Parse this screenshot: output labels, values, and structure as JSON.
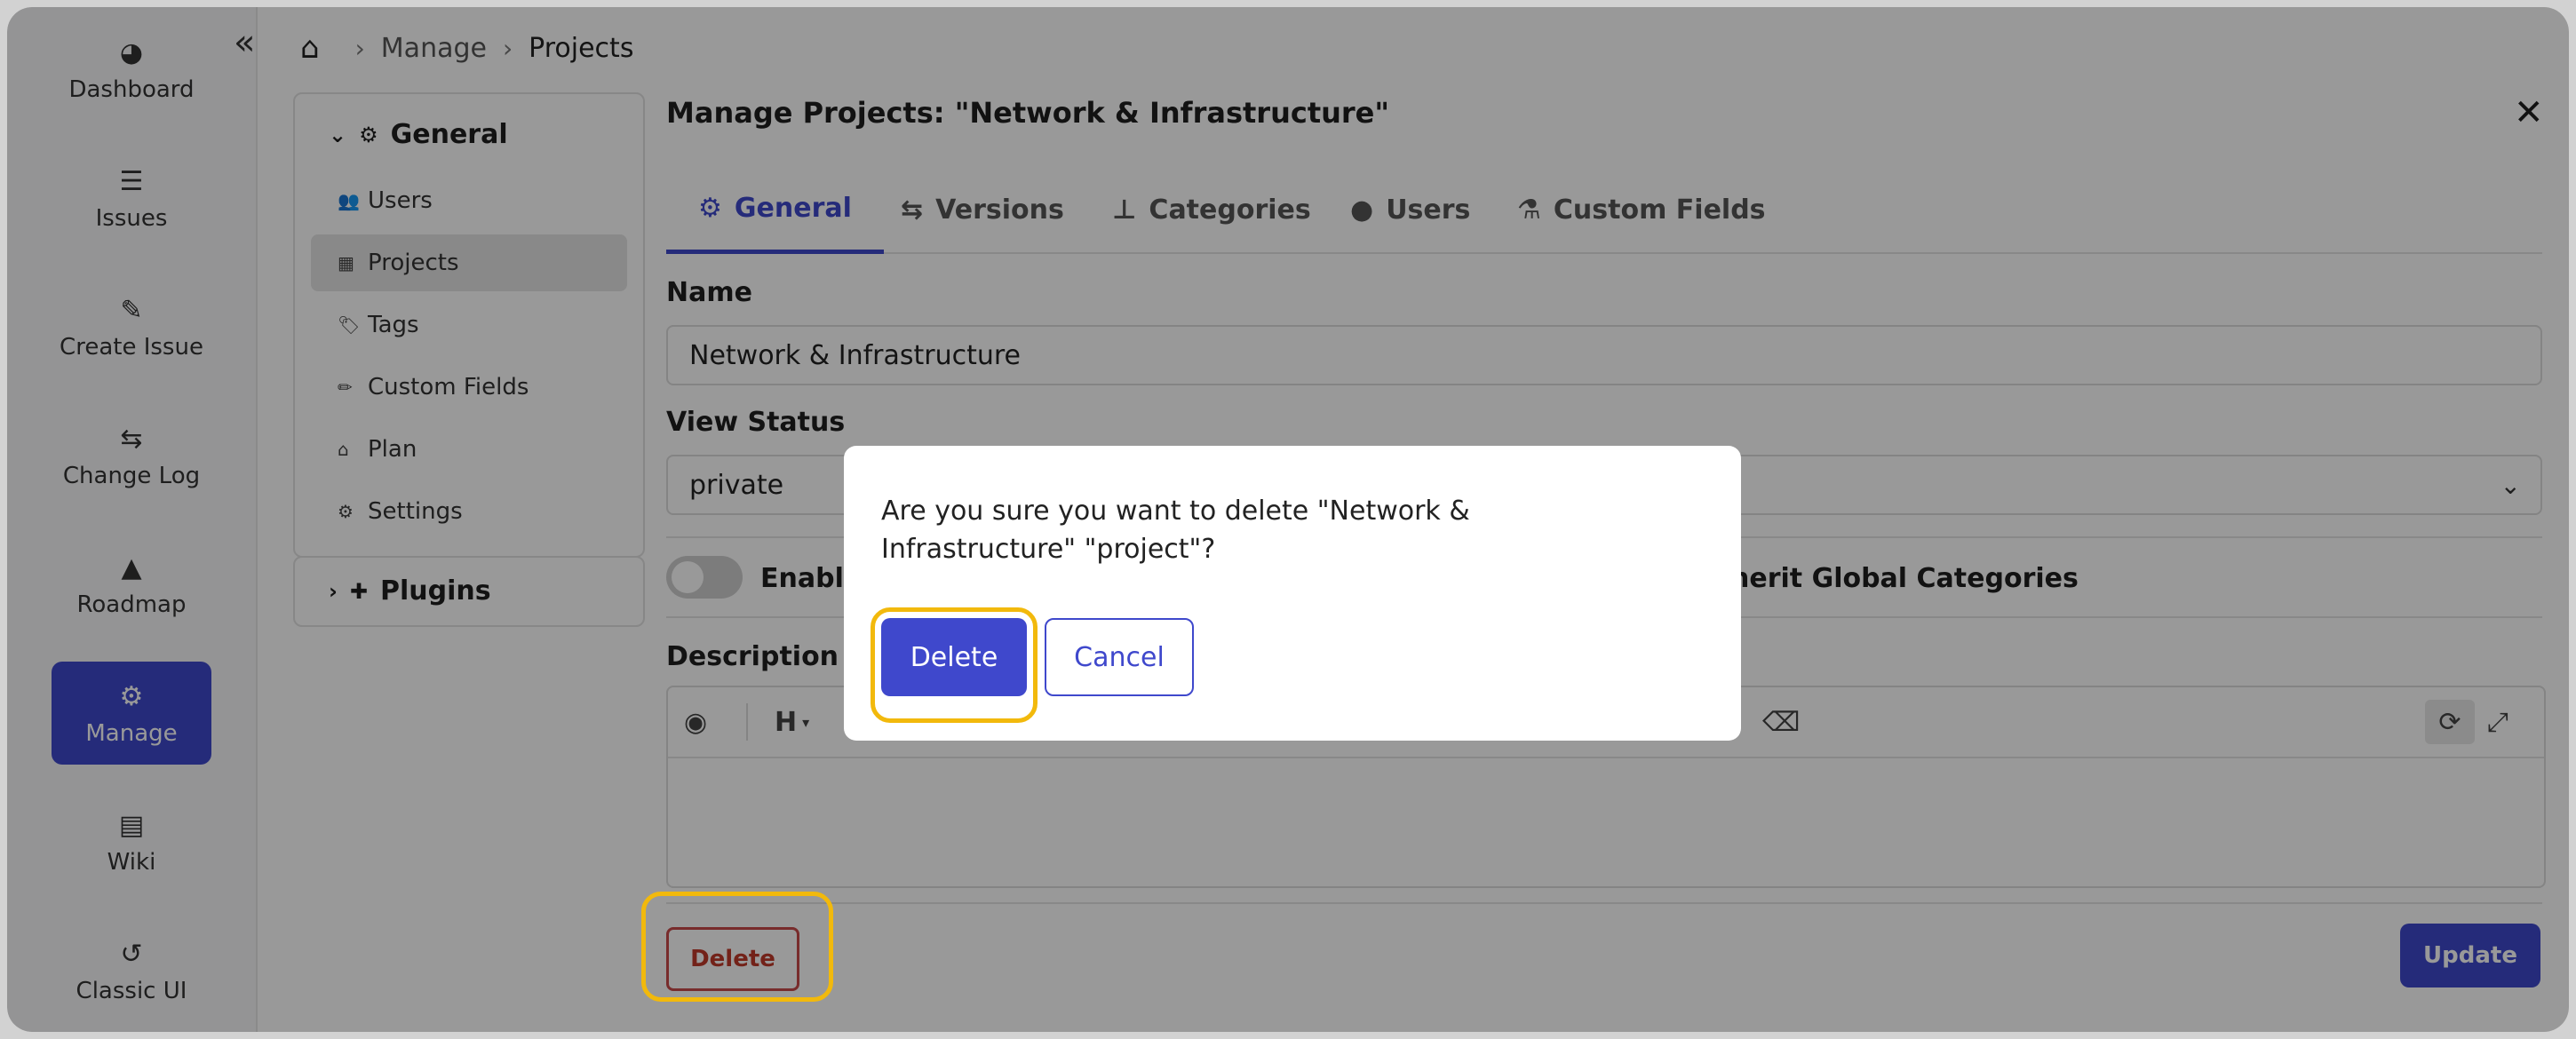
{
  "sidebar": {
    "collapse_icon": "double-chevron-left-icon",
    "items": [
      {
        "label": "Dashboard",
        "icon": "dashboard-gauge-icon"
      },
      {
        "label": "Issues",
        "icon": "list-icon"
      },
      {
        "label": "Create Issue",
        "icon": "edit-icon"
      },
      {
        "label": "Change Log",
        "icon": "retweet-icon"
      },
      {
        "label": "Roadmap",
        "icon": "road-icon"
      },
      {
        "label": "Manage",
        "icon": "cogs-icon",
        "active": true
      },
      {
        "label": "Wiki",
        "icon": "file-icon"
      },
      {
        "label": "Classic UI",
        "icon": "history-icon"
      }
    ],
    "active_color": "#3f48cc"
  },
  "breadcrumb": {
    "home_icon": "home-icon",
    "items": [
      "Manage",
      "Projects"
    ]
  },
  "settings_menu": {
    "general": {
      "title": "General",
      "items": [
        {
          "label": "Users",
          "icon": "users-icon"
        },
        {
          "label": "Projects",
          "icon": "table-icon",
          "active": true
        },
        {
          "label": "Tags",
          "icon": "tags-icon"
        },
        {
          "label": "Custom Fields",
          "icon": "pencil-icon"
        },
        {
          "label": "Plan",
          "icon": "bank-icon"
        },
        {
          "label": "Settings",
          "icon": "gear-icon"
        }
      ]
    },
    "plugins": {
      "title": "Plugins"
    }
  },
  "panel": {
    "title": "Manage Projects: \"Network & Infrastructure\"",
    "tabs": [
      {
        "label": "General",
        "icon": "gear-icon",
        "active": true
      },
      {
        "label": "Versions",
        "icon": "retweet-icon"
      },
      {
        "label": "Categories",
        "icon": "sitemap-icon"
      },
      {
        "label": "Users",
        "icon": "user-icon"
      },
      {
        "label": "Custom Fields",
        "icon": "flask-icon"
      }
    ],
    "name_label": "Name",
    "name_value": "Network & Infrastructure",
    "view_status_label": "View Status",
    "view_status_value": "private",
    "toggle_enable_label": "Enable",
    "toggle_inherit_label": "herit Global Categories",
    "description_label": "Description",
    "editor_toolbar": {
      "heading": "H",
      "icons": [
        "eye-icon",
        "eraser-icon",
        "sync-icon",
        "expand-icon"
      ]
    },
    "delete_label": "Delete",
    "update_label": "Update"
  },
  "modal": {
    "message": "Are you sure you want to delete \"Network & Infrastructure\" \"project\"?",
    "delete_label": "Delete",
    "cancel_label": "Cancel"
  },
  "colors": {
    "accent": "#3f48cc",
    "highlight": "#f2b90c",
    "danger": "#c0392b"
  }
}
